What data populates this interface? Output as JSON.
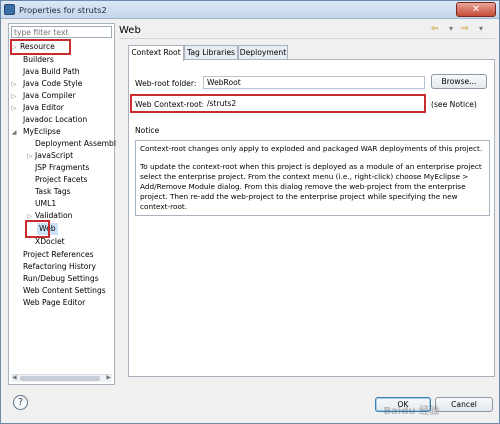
{
  "window": {
    "title": "Properties for struts2",
    "close_label": "✕"
  },
  "sidebar": {
    "filter_placeholder": "type filter text",
    "items": [
      {
        "label": "Resource",
        "arrow": "▷"
      },
      {
        "label": "Builders"
      },
      {
        "label": "Java Build Path"
      },
      {
        "label": "Java Code Style",
        "arrow": "▷"
      },
      {
        "label": "Java Compiler",
        "arrow": "▷"
      },
      {
        "label": "Java Editor",
        "arrow": "▷"
      },
      {
        "label": "Javadoc Location"
      },
      {
        "label": "MyEclipse",
        "arrow": "◢"
      },
      {
        "label": "Deployment Assembl"
      },
      {
        "label": "JavaScript",
        "arrow": "▷"
      },
      {
        "label": "JSP Fragments"
      },
      {
        "label": "Project Facets"
      },
      {
        "label": "Task Tags"
      },
      {
        "label": "UML1"
      },
      {
        "label": "Validation",
        "arrow": "▷"
      },
      {
        "label": "Web"
      },
      {
        "label": "XDoclet"
      },
      {
        "label": "Project References"
      },
      {
        "label": "Refactoring History"
      },
      {
        "label": "Run/Debug Settings"
      },
      {
        "label": "Web Content Settings"
      },
      {
        "label": "Web Page Editor"
      }
    ]
  },
  "header": {
    "title": "Web",
    "nav_back": "⇦",
    "nav_forward": "⇨",
    "nav_menu": "▾"
  },
  "tabs": [
    {
      "label": "Context Root"
    },
    {
      "label": "Tag Libraries"
    },
    {
      "label": "Deployment"
    }
  ],
  "form": {
    "webroot_label": "Web-root folder:",
    "webroot_value": "WebRoot",
    "browse_label": "Browse...",
    "context_label": "Web Context-root:",
    "context_value": "/struts2",
    "see_notice": "(see Notice)"
  },
  "notice": {
    "heading": "Notice",
    "para1": "Context-root changes only apply to exploded and packaged WAR deployments of this project.",
    "para2": "To update the context-root when this project is deployed as a module of an enterprise project select the enterprise project. From the context menu (i.e., right-click) choose MyEclipse > Add/Remove Module dialog. From this dialog remove the web-project from the enterprise project. Then re-add the web-project to the enterprise project while specifying the new context-root."
  },
  "footer": {
    "ok_label": "OK",
    "cancel_label": "Cancel",
    "help_label": "?",
    "watermark": "Baidu 经验"
  },
  "colors": {
    "highlight": "#c92c2c",
    "accent": "#3c7fb1"
  }
}
